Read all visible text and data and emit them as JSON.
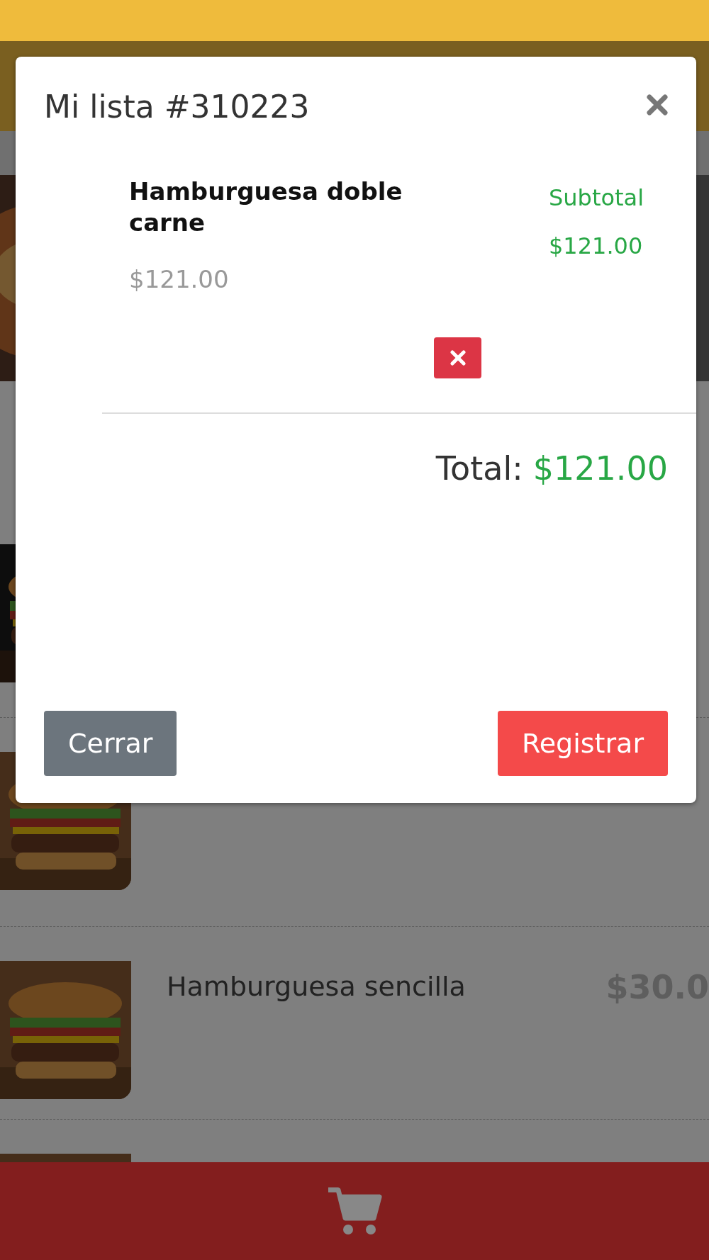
{
  "dialog": {
    "title": "Mi lista #310223",
    "items": [
      {
        "name": "Hamburguesa doble carne",
        "price": "$121.00",
        "subtotal_label": "Subtotal",
        "subtotal": "$121.00"
      }
    ],
    "total_label": "Total:",
    "total": "$121.00",
    "buttons": [
      {
        "label": "Cerrar",
        "kind": "secondary"
      },
      {
        "label": "Registrar",
        "kind": "primary"
      }
    ]
  },
  "background_list": {
    "items": [
      {
        "kind": "picture"
      },
      {
        "kind": "picture"
      },
      {
        "kind": "product",
        "name": "Hamburguesa sencilla",
        "price": "$30.0"
      },
      {
        "kind": "picture"
      }
    ]
  }
}
